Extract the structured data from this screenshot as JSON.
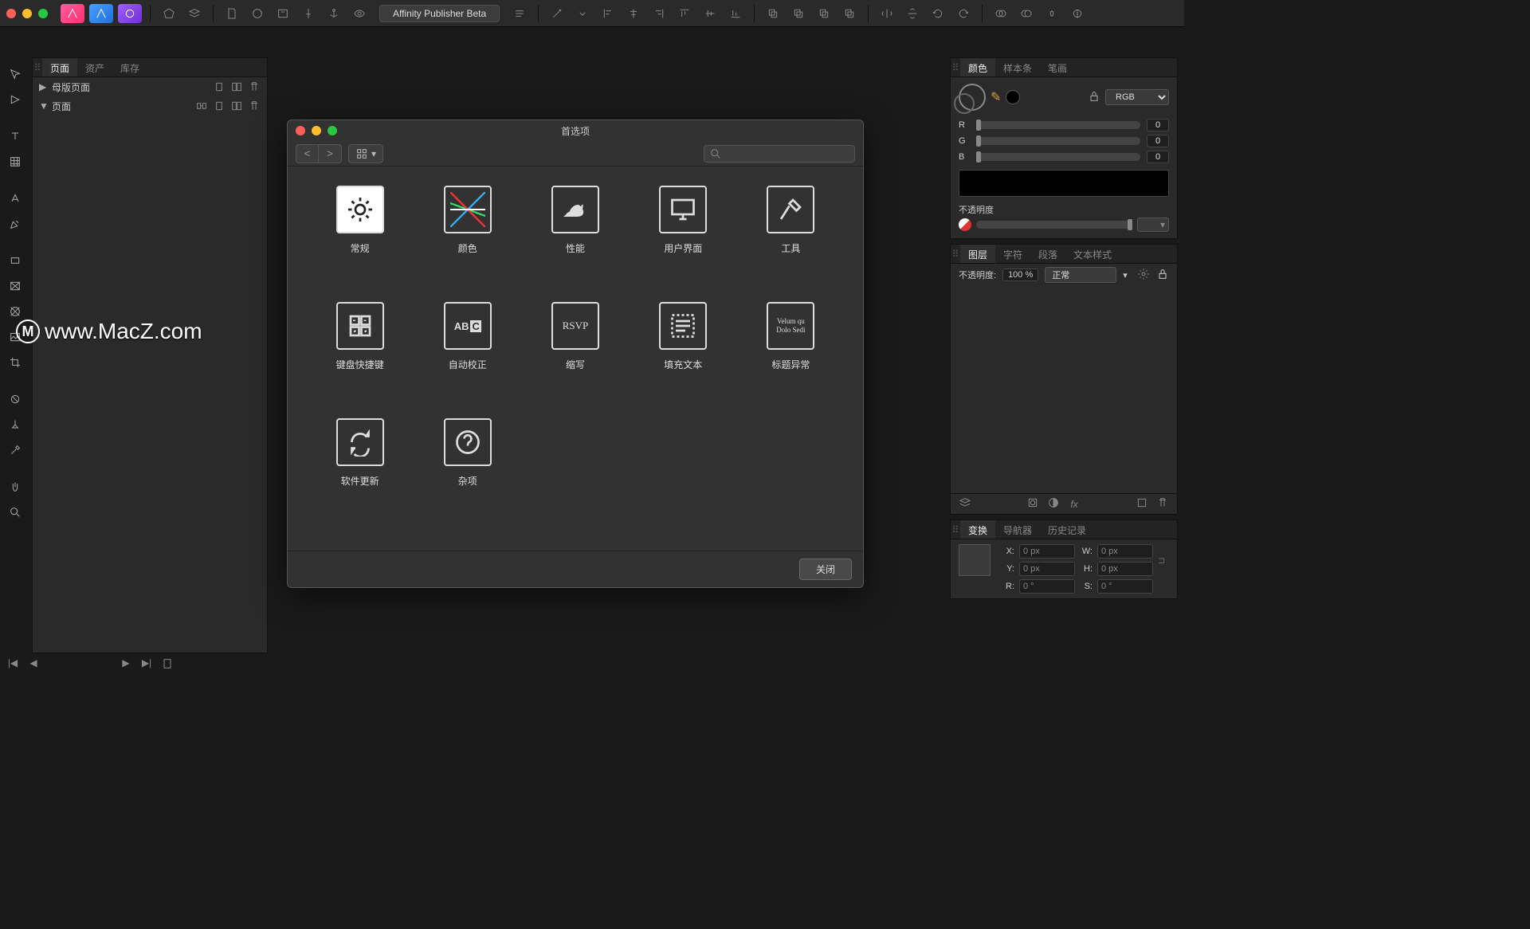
{
  "app": {
    "title": "Affinity Publisher Beta"
  },
  "left_panel": {
    "tabs": [
      "页面",
      "资产",
      "库存"
    ],
    "rows": [
      {
        "label": "母版页面",
        "expanded": false
      },
      {
        "label": "页面",
        "expanded": true
      }
    ]
  },
  "color_panel": {
    "tabs": [
      "颜色",
      "样本条",
      "笔画"
    ],
    "mode": "RGB",
    "channels": [
      {
        "label": "R",
        "value": "0"
      },
      {
        "label": "G",
        "value": "0"
      },
      {
        "label": "B",
        "value": "0"
      }
    ],
    "opacity_label": "不透明度"
  },
  "layers_panel": {
    "tabs": [
      "图层",
      "字符",
      "段落",
      "文本样式"
    ],
    "opacity_label": "不透明度:",
    "opacity_value": "100 %",
    "blend_mode": "正常"
  },
  "transform_panel": {
    "tabs": [
      "变换",
      "导航器",
      "历史记录"
    ],
    "fields": {
      "x_label": "X:",
      "x_value": "0 px",
      "y_label": "Y:",
      "y_value": "0 px",
      "w_label": "W:",
      "w_value": "0 px",
      "h_label": "H:",
      "h_value": "0 px",
      "r_label": "R:",
      "r_value": "0 °",
      "s_label": "S:",
      "s_value": "0 °"
    }
  },
  "prefs": {
    "title": "首选项",
    "close": "关闭",
    "items": [
      {
        "label": "常规",
        "icon": "gear"
      },
      {
        "label": "颜色",
        "icon": "colors"
      },
      {
        "label": "性能",
        "icon": "cat"
      },
      {
        "label": "用户界面",
        "icon": "monitor"
      },
      {
        "label": "工具",
        "icon": "hammer"
      },
      {
        "label": "键盘快捷键",
        "icon": "keys"
      },
      {
        "label": "自动校正",
        "icon": "abc"
      },
      {
        "label": "缩写",
        "icon": "rsvp"
      },
      {
        "label": "填充文本",
        "icon": "textblock"
      },
      {
        "label": "标题异常",
        "icon": "lorem"
      },
      {
        "label": "软件更新",
        "icon": "update"
      },
      {
        "label": "杂项",
        "icon": "question"
      }
    ]
  },
  "watermark": "www.MacZ.com"
}
